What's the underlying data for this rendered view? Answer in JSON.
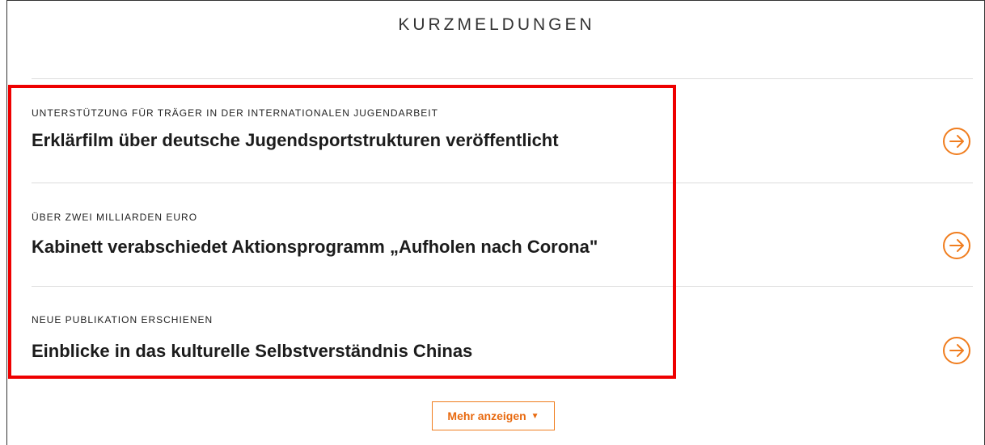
{
  "section": {
    "title": "KURZMELDUNGEN"
  },
  "news": {
    "items": [
      {
        "kicker": "UNTERSTÜTZUNG FÜR TRÄGER IN DER INTERNATIONALEN JUGENDARBEIT",
        "headline": "Erklärfilm über deutsche Jugendsportstrukturen veröffentlicht"
      },
      {
        "kicker": "ÜBER ZWEI MILLIARDEN EURO",
        "headline": "Kabinett verabschiedet Aktionsprogramm „Aufholen nach Corona\""
      },
      {
        "kicker": "NEUE PUBLIKATION ERSCHIENEN",
        "headline": "Einblicke in das kulturelle Selbstverständnis Chinas"
      }
    ]
  },
  "more": {
    "label": "Mehr anzeigen",
    "caret": "▼"
  },
  "colors": {
    "accent": "#f07d1e",
    "highlight": "#ee0000"
  },
  "icons": {
    "arrow": "arrow-right-circle-icon"
  }
}
